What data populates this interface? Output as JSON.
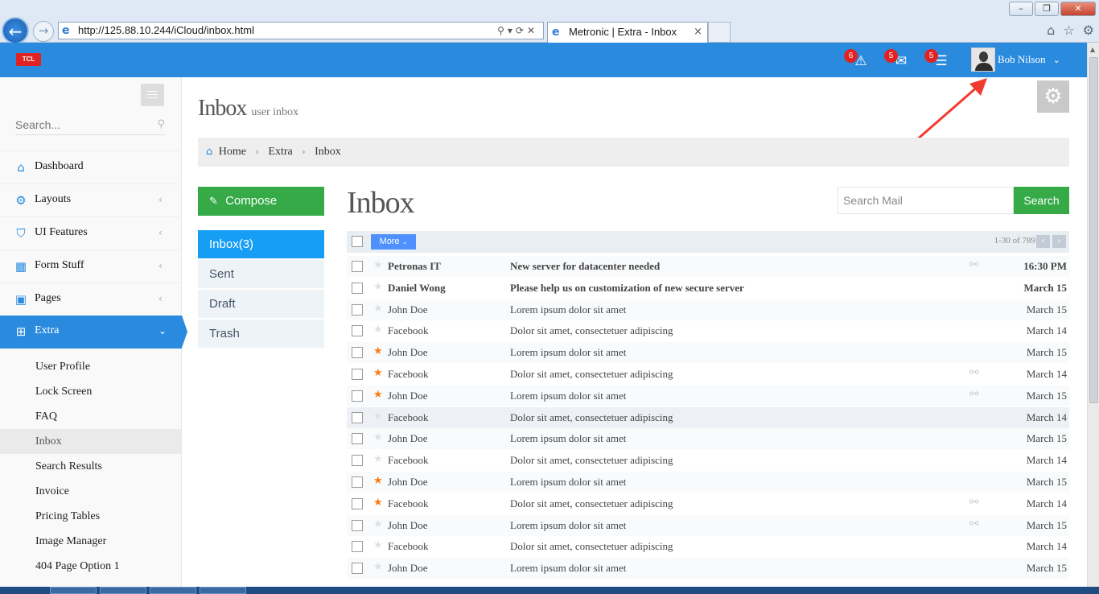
{
  "browser": {
    "url": "http://125.88.10.244/iCloud/inbox.html",
    "tab_title": "Metronic | Extra - Inbox",
    "tab_close": "×"
  },
  "header": {
    "logo": "TCL",
    "notif_badge": "6",
    "inbox_badge": "5",
    "tasks_badge": "5",
    "user_name": "Bob Nilson"
  },
  "sidebar": {
    "search_placeholder": "Search...",
    "items": [
      {
        "label": "Dashboard",
        "icon": "home-icon"
      },
      {
        "label": "Layouts",
        "icon": "cogs-icon"
      },
      {
        "label": "UI Features",
        "icon": "bookmark-icon"
      },
      {
        "label": "Form Stuff",
        "icon": "table-icon"
      },
      {
        "label": "Pages",
        "icon": "briefcase-icon"
      },
      {
        "label": "Extra",
        "icon": "gift-icon"
      }
    ],
    "sub_items": [
      "User Profile",
      "Lock Screen",
      "FAQ",
      "Inbox",
      "Search Results",
      "Invoice",
      "Pricing Tables",
      "Image Manager",
      "404 Page Option 1"
    ]
  },
  "page": {
    "title": "Inbox",
    "subtitle": "user inbox",
    "breadcrumb": [
      "Home",
      "Extra",
      "Inbox"
    ]
  },
  "mail": {
    "compose_label": "Compose",
    "folders": [
      "Inbox(3)",
      "Sent",
      "Draft",
      "Trash"
    ],
    "heading": "Inbox",
    "search_placeholder": "Search Mail",
    "search_button": "Search",
    "more_button": "More",
    "pager": "1-30 of 789",
    "rows": [
      {
        "from": "Petronas IT",
        "subject": "New server for datacenter needed",
        "date": "16:30 PM",
        "starred": false,
        "attachment": true,
        "unread": true
      },
      {
        "from": "Daniel Wong",
        "subject": "Please help us on customization of new secure server",
        "date": "March 15",
        "starred": false,
        "attachment": false,
        "unread": true
      },
      {
        "from": "John Doe",
        "subject": "Lorem ipsum dolor sit amet",
        "date": "March 15",
        "starred": false,
        "attachment": false,
        "unread": false
      },
      {
        "from": "Facebook",
        "subject": "Dolor sit amet, consectetuer adipiscing",
        "date": "March 14",
        "starred": false,
        "attachment": false,
        "unread": false
      },
      {
        "from": "John Doe",
        "subject": "Lorem ipsum dolor sit amet",
        "date": "March 15",
        "starred": true,
        "attachment": false,
        "unread": false
      },
      {
        "from": "Facebook",
        "subject": "Dolor sit amet, consectetuer adipiscing",
        "date": "March 14",
        "starred": true,
        "attachment": true,
        "unread": false
      },
      {
        "from": "John Doe",
        "subject": "Lorem ipsum dolor sit amet",
        "date": "March 15",
        "starred": true,
        "attachment": true,
        "unread": false
      },
      {
        "from": "Facebook",
        "subject": "Dolor sit amet, consectetuer adipiscing",
        "date": "March 14",
        "starred": false,
        "attachment": false,
        "unread": false
      },
      {
        "from": "John Doe",
        "subject": "Lorem ipsum dolor sit amet",
        "date": "March 15",
        "starred": false,
        "attachment": false,
        "unread": false
      },
      {
        "from": "Facebook",
        "subject": "Dolor sit amet, consectetuer adipiscing",
        "date": "March 14",
        "starred": false,
        "attachment": false,
        "unread": false
      },
      {
        "from": "John Doe",
        "subject": "Lorem ipsum dolor sit amet",
        "date": "March 15",
        "starred": true,
        "attachment": false,
        "unread": false
      },
      {
        "from": "Facebook",
        "subject": "Dolor sit amet, consectetuer adipiscing",
        "date": "March 14",
        "starred": true,
        "attachment": true,
        "unread": false
      },
      {
        "from": "John Doe",
        "subject": "Lorem ipsum dolor sit amet",
        "date": "March 15",
        "starred": false,
        "attachment": true,
        "unread": false
      },
      {
        "from": "Facebook",
        "subject": "Dolor sit amet, consectetuer adipiscing",
        "date": "March 14",
        "starred": false,
        "attachment": false,
        "unread": false
      },
      {
        "from": "John Doe",
        "subject": "Lorem ipsum dolor sit amet",
        "date": "March 15",
        "starred": false,
        "attachment": false,
        "unread": false
      }
    ]
  },
  "colors": {
    "brand_blue": "#2a8bde",
    "compose_green": "#35aa47",
    "badge_red": "#e02222",
    "star_orange": "#fd7b12",
    "annotation_red": "#f03b30"
  }
}
